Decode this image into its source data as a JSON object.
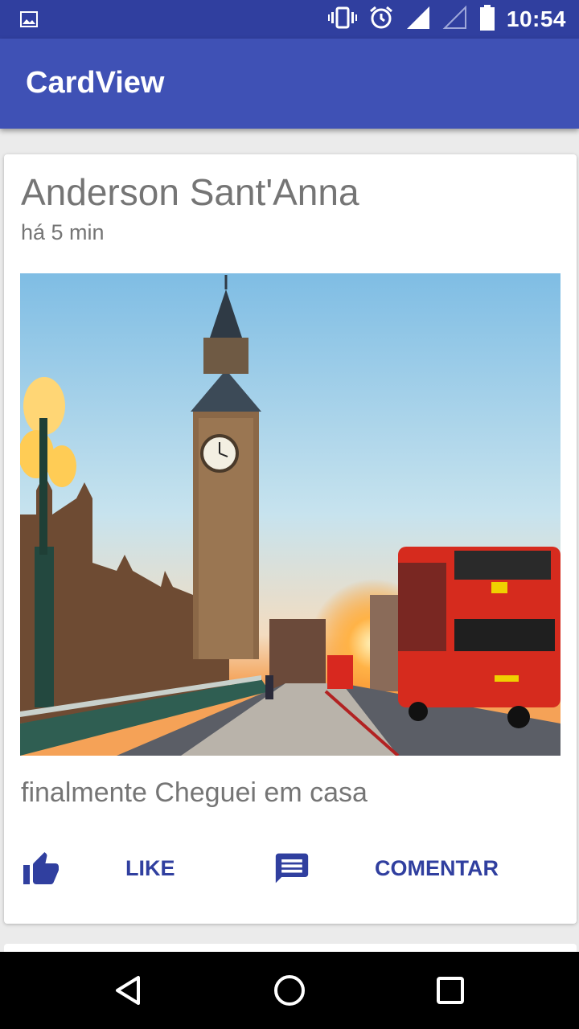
{
  "status_bar": {
    "time": "10:54",
    "icons": [
      "image-notification-icon",
      "vibrate-icon",
      "alarm-icon",
      "signal-icon",
      "signal-empty-icon",
      "battery-icon"
    ]
  },
  "app_bar": {
    "title": "CardView"
  },
  "card": {
    "author": "Anderson Sant'Anna",
    "time": "há 5 min",
    "image_alt": "London Big Ben with red double-decker bus",
    "text": "finalmente Cheguei em casa",
    "actions": {
      "like_label": "LIKE",
      "comment_label": "COMENTAR"
    }
  },
  "nav_bar": {
    "icons": [
      "back-icon",
      "home-icon",
      "recents-icon"
    ]
  },
  "colors": {
    "status_bar": "#303f9f",
    "primary": "#3f51b5",
    "accent_text": "#303f9f",
    "secondary_text": "#757575"
  }
}
